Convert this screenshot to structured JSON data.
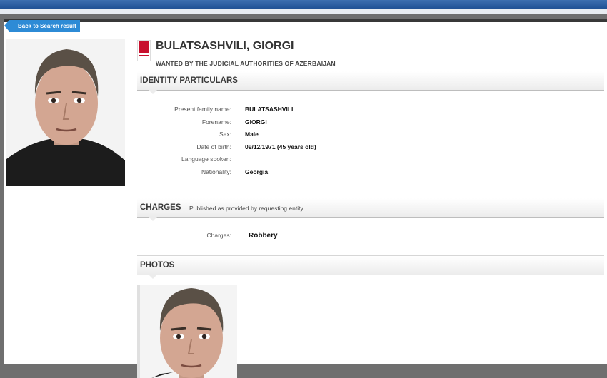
{
  "nav": {
    "back_label": "Back to Search result"
  },
  "person": {
    "name": "BULATSASHVILI, GIORGI",
    "wanted_by": "WANTED BY THE JUDICIAL AUTHORITIES OF AZERBAIJAN"
  },
  "identity": {
    "title": "IDENTITY PARTICULARS",
    "fields": [
      {
        "label": "Present family name:",
        "value": "BULATSASHVILI"
      },
      {
        "label": "Forename:",
        "value": "GIORGI"
      },
      {
        "label": "Sex:",
        "value": "Male"
      },
      {
        "label": "Date of birth:",
        "value": "09/12/1971 (45 years old)"
      },
      {
        "label": "Language spoken:",
        "value": ""
      },
      {
        "label": "Nationality:",
        "value": "Georgia"
      }
    ]
  },
  "charges": {
    "title": "CHARGES",
    "subtitle": "Published as provided by requesting entity",
    "label": "Charges:",
    "value": "Robbery"
  },
  "photos": {
    "title": "PHOTOS"
  },
  "icons": {
    "logo": "interpol-logo-icon",
    "back": "back-arrow-icon"
  },
  "colors": {
    "accent": "#2d8bd6",
    "topbar": "#1e4f93",
    "logo_red": "#c8102e"
  }
}
